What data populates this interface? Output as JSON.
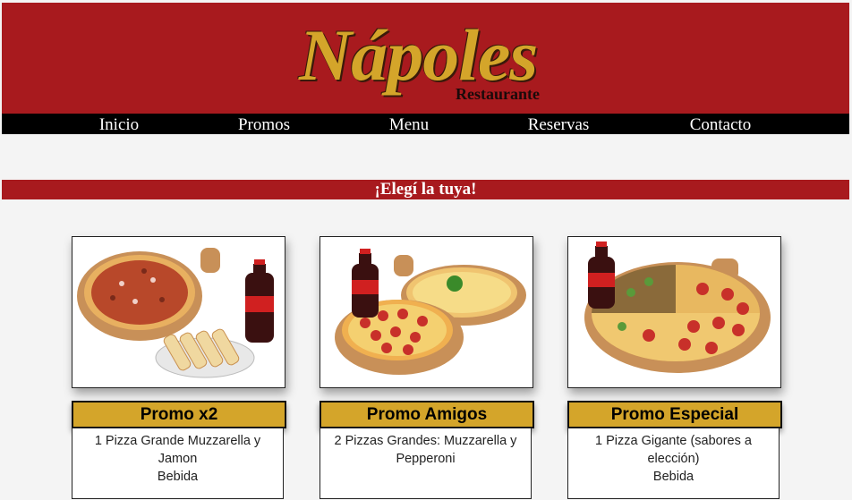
{
  "brand": {
    "name": "Nápoles",
    "subtitle": "Restaurante",
    "primary_color": "#a81a1e",
    "gold_color": "#d4a52a"
  },
  "nav": {
    "items": [
      {
        "label": "Inicio"
      },
      {
        "label": "Promos"
      },
      {
        "label": "Menu"
      },
      {
        "label": "Reservas"
      },
      {
        "label": "Contacto"
      }
    ]
  },
  "banner": {
    "text": "¡Elegí la tuya!"
  },
  "promos": [
    {
      "title": "Promo x2",
      "lines": [
        "1 Pizza Grande Muzzarella y Jamon",
        "Bebida"
      ],
      "image": "pizza-x2-image"
    },
    {
      "title": "Promo Amigos",
      "lines": [
        "2 Pizzas Grandes: Muzzarella y Pepperoni"
      ],
      "image": "pizza-amigos-image"
    },
    {
      "title": "Promo Especial",
      "lines": [
        "1 Pizza Gigante (sabores a elección)",
        "Bebida"
      ],
      "image": "pizza-especial-image"
    }
  ]
}
